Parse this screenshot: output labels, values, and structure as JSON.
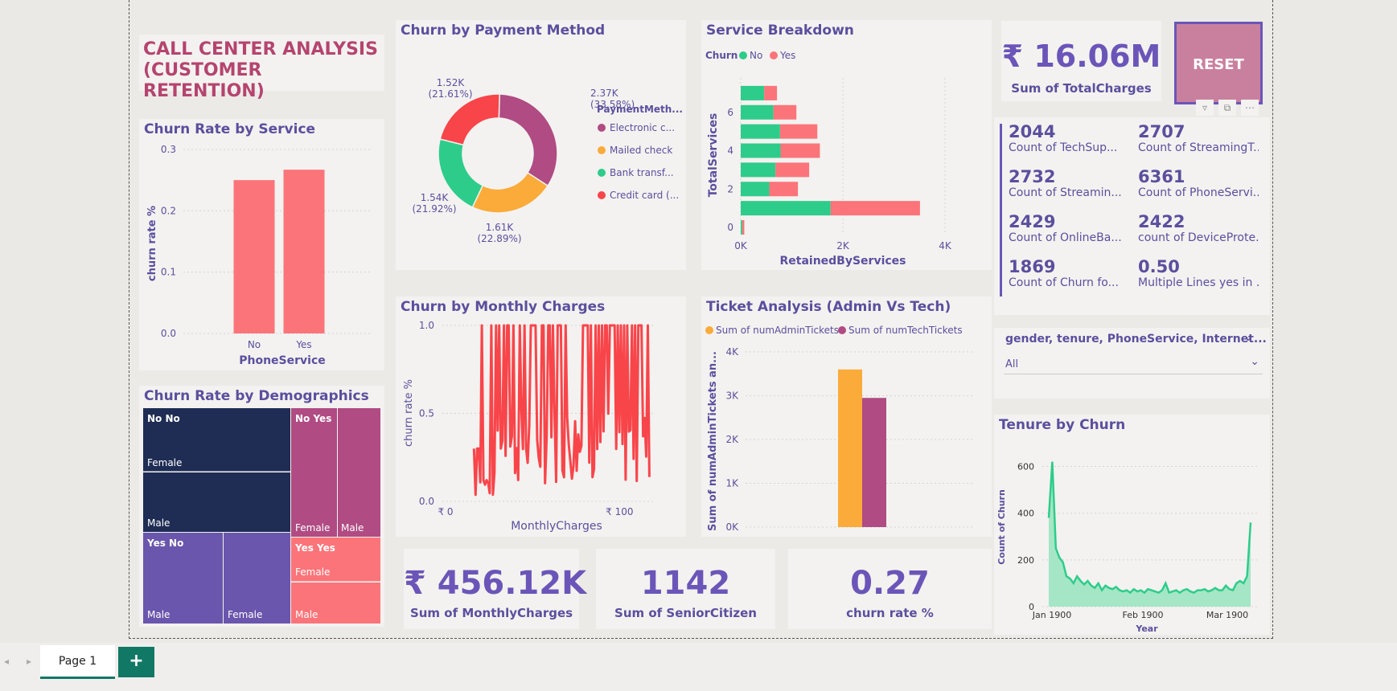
{
  "header": {
    "title_line1": "CALL CENTER ANALYSIS",
    "title_line2": "(CUSTOMER RETENTION)"
  },
  "reset_label": "RESET",
  "total_charges": {
    "value": "₹ 16.06M",
    "label": "Sum of TotalCharges"
  },
  "kpis": [
    {
      "value": "2044",
      "label": "Count of TechSup..."
    },
    {
      "value": "2707",
      "label": "Count of StreamingT..."
    },
    {
      "value": "2732",
      "label": "Count of Streamin..."
    },
    {
      "value": "6361",
      "label": "Count of PhoneServi..."
    },
    {
      "value": "2429",
      "label": "Count of OnlineBa..."
    },
    {
      "value": "2422",
      "label": "count of DeviceProte..."
    },
    {
      "value": "1869",
      "label": "Count of Churn fo..."
    },
    {
      "value": "0.50",
      "label": "Multiple Lines yes in ..."
    }
  ],
  "filter": {
    "title": "gender, tenure, PhoneService, Internet...",
    "value": "All"
  },
  "bottom_kpis": [
    {
      "value": "₹ 456.12K",
      "label": "Sum of MonthlyCharges"
    },
    {
      "value": "1142",
      "label": "Sum of SeniorCitizen"
    },
    {
      "value": "0.27",
      "label": "churn rate %"
    }
  ],
  "tabs": {
    "page": "Page 1",
    "add": "+"
  },
  "colors": {
    "accent": "#6b55b8",
    "green": "#2ecc8a",
    "pink": "#fb7479",
    "red": "#f8454a",
    "orange": "#fbab3a",
    "magenta": "#b04b83",
    "navy": "#1f2d55"
  },
  "chart_data": [
    {
      "type": "bar",
      "title": "Churn Rate by Service",
      "xlabel": "PhoneService",
      "ylabel": "churn rate %",
      "categories": [
        "No",
        "Yes"
      ],
      "values": [
        0.25,
        0.267
      ],
      "ylim": [
        0,
        0.3
      ],
      "yticks": [
        "0.0",
        "0.1",
        "0.2",
        "0.3"
      ]
    },
    {
      "type": "pie",
      "title": "Churn by Payment Method",
      "legend_title": "PaymentMeth...",
      "labels": [
        "Electronic c...",
        "Mailed check",
        "Bank transf...",
        "Credit card (..."
      ],
      "values": [
        2370,
        1610,
        1540,
        1520
      ],
      "data_labels": [
        "2.37K\n(33.58%)",
        "1.61K\n(22.89%)",
        "1.54K\n(21.92%)",
        "1.52K\n(21.61%)"
      ]
    },
    {
      "type": "bar",
      "title": "Service Breakdown",
      "legend_title": "Churn",
      "xlabel": "RetainedByServices",
      "ylabel": "TotalServices",
      "y": [
        0,
        1,
        2,
        3,
        4,
        5,
        6,
        7
      ],
      "series": [
        {
          "name": "No",
          "values": [
            30,
            1760,
            560,
            680,
            780,
            770,
            640,
            460
          ]
        },
        {
          "name": "Yes",
          "values": [
            40,
            1750,
            560,
            660,
            770,
            730,
            450,
            250
          ]
        }
      ],
      "xlim": [
        0,
        4000
      ],
      "xticks": [
        "0K",
        "2K",
        "4K"
      ],
      "yticks": [
        "0",
        "2",
        "4",
        "6"
      ]
    },
    {
      "type": "line",
      "title": "Churn by Monthly Charges",
      "xlabel": "MonthlyCharges",
      "ylabel": "churn rate %",
      "xlim": [
        0,
        120
      ],
      "ylim": [
        0,
        1
      ],
      "xticks": [
        "₹ 0",
        "₹ 100"
      ],
      "yticks": [
        "0.0",
        "0.5",
        "1.0"
      ]
    },
    {
      "type": "bar",
      "title": "Ticket Analysis (Admin Vs Tech)",
      "ylabel": "Sum of numAdminTickets an...",
      "series": [
        {
          "name": "Sum of numAdminTickets",
          "values": [
            3600
          ]
        },
        {
          "name": "Sum of numTechTickets",
          "values": [
            2950
          ]
        }
      ],
      "ylim": [
        0,
        4000
      ],
      "yticks": [
        "0K",
        "1K",
        "2K",
        "3K",
        "4K"
      ]
    },
    {
      "type": "area",
      "title": "Tenure by Churn",
      "xlabel": "Year",
      "ylabel": "Count of Churn",
      "xticks": [
        "Jan 1900",
        "Feb 1900",
        "Mar 1900"
      ],
      "yticks": [
        "0",
        "200",
        "400",
        "600"
      ],
      "ylim": [
        0,
        650
      ],
      "values": [
        380,
        620,
        250,
        210,
        190,
        130,
        120,
        100,
        130,
        110,
        95,
        110,
        90,
        80,
        100,
        70,
        90,
        80,
        75,
        85,
        70,
        65,
        70,
        60,
        75,
        65,
        70,
        60,
        75,
        70,
        65,
        60,
        70,
        100,
        60,
        65,
        70,
        60,
        70,
        75,
        65,
        60,
        70,
        70,
        75,
        65,
        70,
        80,
        70,
        70,
        90,
        75,
        70,
        100,
        110,
        100,
        130,
        360
      ]
    },
    {
      "type": "heatmap",
      "title": "Churn Rate by Demographics",
      "groups": [
        {
          "name": "No No",
          "children": [
            "Female",
            "Male"
          ]
        },
        {
          "name": "No Yes",
          "children": [
            "Female",
            "Male"
          ]
        },
        {
          "name": "Yes No",
          "children": [
            "Male",
            "Female"
          ]
        },
        {
          "name": "Yes Yes",
          "children": [
            "Female",
            "Male"
          ]
        }
      ]
    }
  ]
}
